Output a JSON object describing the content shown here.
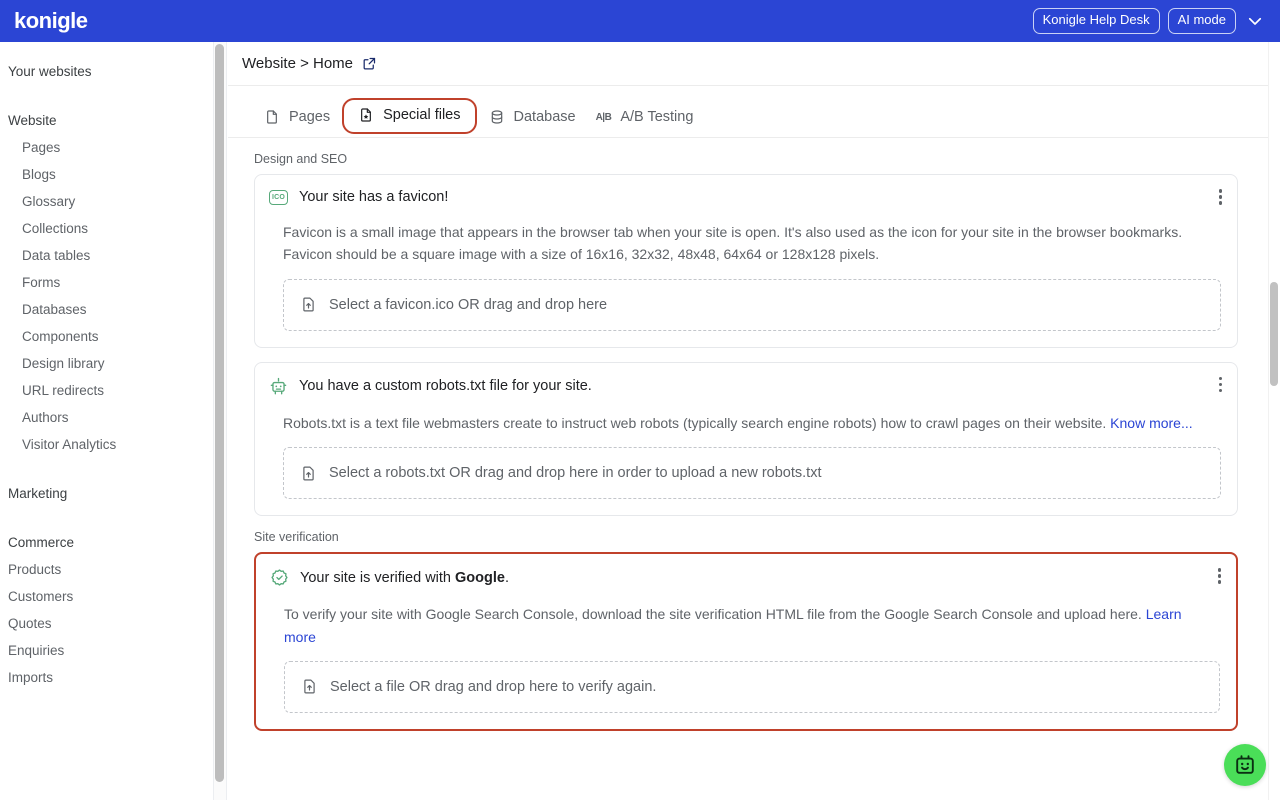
{
  "topbar": {
    "brand": "konigle",
    "help_desk_label": "Konigle Help Desk",
    "ai_mode_label": "AI mode",
    "chevron_icon": "chevron-down-icon",
    "accent_color": "#2b45d4"
  },
  "sidebar": {
    "top_label": "Your websites",
    "groups": [
      {
        "label": "Website",
        "items": [
          "Pages",
          "Blogs",
          "Glossary",
          "Collections",
          "Data tables",
          "Forms",
          "Databases",
          "Components",
          "Design library",
          "URL redirects",
          "Authors",
          "Visitor Analytics"
        ]
      },
      {
        "label": "Marketing",
        "items": []
      },
      {
        "label": "Commerce",
        "items": []
      }
    ],
    "flat_items": [
      "Products",
      "Customers",
      "Quotes",
      "Enquiries",
      "Imports"
    ]
  },
  "breadcrumb": {
    "text": "Website > Home",
    "external_icon": "external-link-icon"
  },
  "tabs": [
    {
      "label": "Pages",
      "icon": "file-icon",
      "active": false,
      "highlighted": false
    },
    {
      "label": "Special files",
      "icon": "special-file-icon",
      "active": true,
      "highlighted": true
    },
    {
      "label": "Database",
      "icon": "database-icon",
      "active": false,
      "highlighted": false
    },
    {
      "label": "A/B Testing",
      "icon": "ab-testing-icon",
      "active": false,
      "highlighted": false
    }
  ],
  "sections": [
    {
      "label": "Design and SEO",
      "cards": [
        {
          "icon": "ico-file-icon",
          "title": "Your site has a favicon!",
          "body": "Favicon is a small image that appears in the browser tab when your site is open. It's also used as the icon for your site in the browser bookmarks. Favicon should be a square image with a size of 16x16, 32x32, 48x48, 64x64 or 128x128 pixels.",
          "link_text": "",
          "dropzone": "Select a favicon.ico OR drag and drop here",
          "highlighted": false
        },
        {
          "icon": "robot-icon",
          "title": "You have a custom robots.txt file for your site.",
          "body": "Robots.txt is a text file webmasters create to instruct web robots (typically search engine robots) how to crawl pages on their website. ",
          "link_text": "Know more...",
          "dropzone": "Select a robots.txt OR drag and drop here in order to upload a new robots.txt",
          "highlighted": false
        }
      ]
    },
    {
      "label": "Site verification",
      "cards": [
        {
          "icon": "verified-badge-icon",
          "title_prefix": "Your site is verified with ",
          "title_bold": "Google",
          "title_suffix": ".",
          "body": "To verify your site with Google Search Console, download the site verification HTML file from the Google Search Console and upload here. ",
          "link_text": "Learn more",
          "dropzone": "Select a file OR drag and drop here to verify again.",
          "highlighted": true
        }
      ]
    }
  ],
  "fab": {
    "icon": "chatbot-robot-icon",
    "color": "#4ade58"
  },
  "highlight_color": "#c0412b",
  "link_color": "#2b45d4"
}
